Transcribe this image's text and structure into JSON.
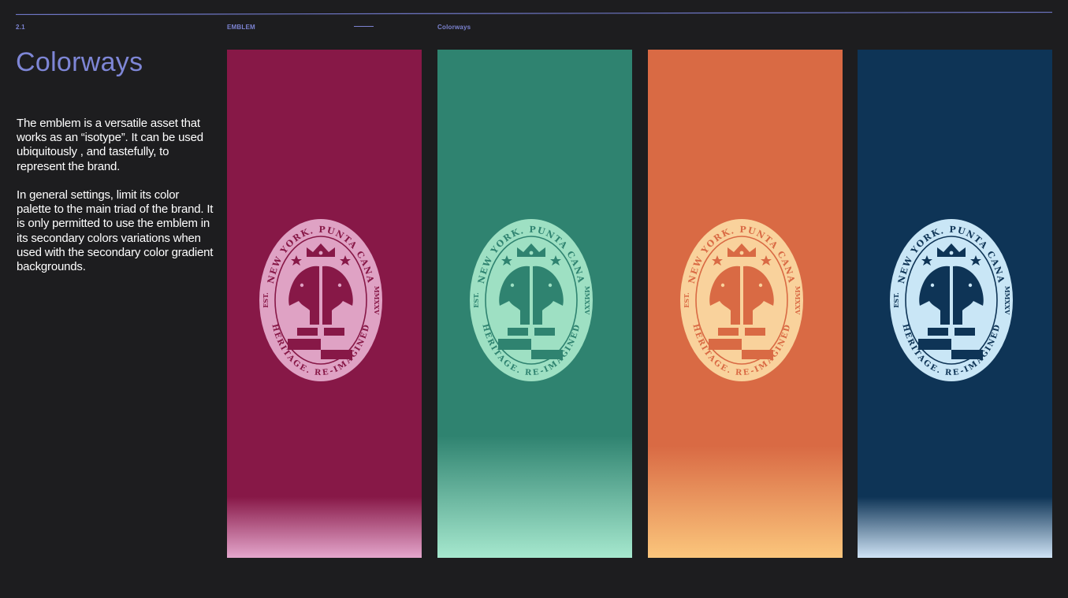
{
  "header": {
    "section_number": "2.1",
    "section_name": "EMBLEM",
    "page_name": "Colorways"
  },
  "main": {
    "title": "Colorways",
    "paragraph_1": "The emblem is a versatile asset that works as an “isotype”. It can be used ubiquitously , and tastefully, to represent the brand.",
    "paragraph_2": "In general settings, limit its color palette to the main triad of the brand. It is only permitted to use the emblem in its secondary colors variations when used with the secondary color gradient backgrounds."
  },
  "emblem_text": {
    "top_arc": "NEW YORK. PUNTA CANA",
    "bottom_arc": "HERITAGE. RE-IMAGINED",
    "left": "EST.",
    "right": "MMXXV"
  },
  "colorways": [
    {
      "name": "magenta",
      "background": "#871847",
      "gradient_end": "#e4a6cc",
      "emblem_color": "#dfa2c4"
    },
    {
      "name": "teal",
      "background": "#2f8370",
      "gradient_end": "#a6e8ce",
      "emblem_color": "#9ee0c3"
    },
    {
      "name": "orange",
      "background": "#d96a44",
      "gradient_end": "#fbc67c",
      "emblem_color": "#f9d29c"
    },
    {
      "name": "navy",
      "background": "#0e3456",
      "gradient_end": "#cfe3f5",
      "emblem_color": "#c9e6f6"
    }
  ],
  "colors": {
    "accent": "#7b82d0",
    "page_background": "#1d1d1f",
    "body_text": "#ffffff"
  }
}
